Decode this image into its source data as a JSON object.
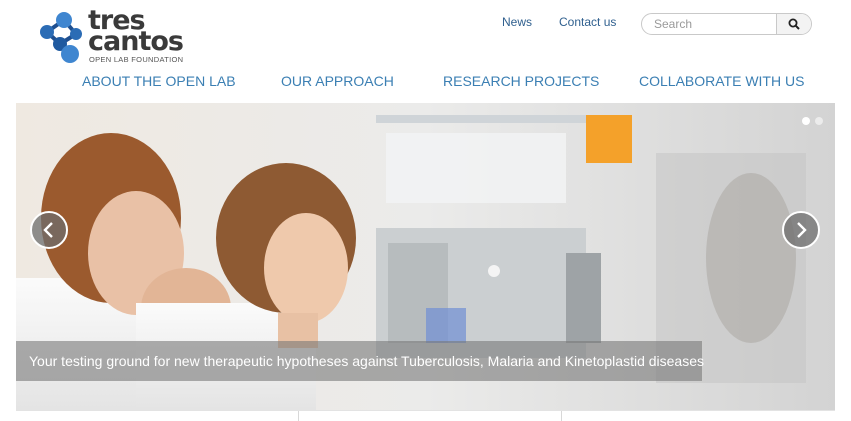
{
  "logo": {
    "line1": "tres",
    "line2": "cantos",
    "subtitle": "OPEN LAB FOUNDATION"
  },
  "top_links": {
    "news": "News",
    "contact": "Contact us"
  },
  "search": {
    "placeholder": "Search"
  },
  "nav": [
    "ABOUT THE OPEN LAB",
    "OUR APPROACH",
    "RESEARCH PROJECTS",
    "COLLABORATE WITH US"
  ],
  "hero": {
    "caption": "Your testing ground for new therapeutic hypotheses against Tuberculosis, Malaria and Kinetoplastid diseases",
    "prev_icon": "chevron-left-icon",
    "next_icon": "chevron-right-icon",
    "slide_count": 2,
    "active_slide": 1
  },
  "colors": {
    "brand_blue": "#2f6fb0",
    "nav_blue": "#3b7fb3",
    "link_blue": "#2f5f8e",
    "text_dark": "#3a3a3a"
  }
}
